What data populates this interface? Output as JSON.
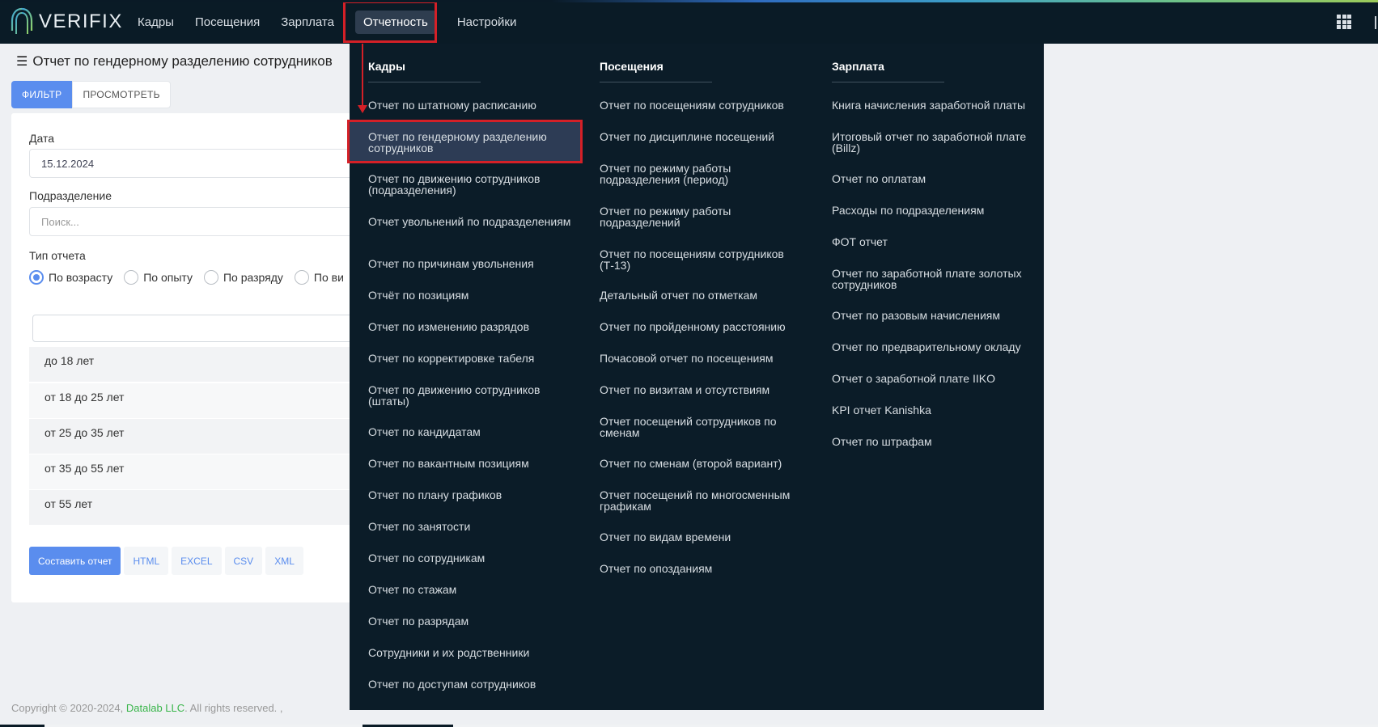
{
  "brand": {
    "name": "VERIFIX"
  },
  "nav": {
    "items": [
      "Кадры",
      "Посещения",
      "Зарплата",
      "Отчетность",
      "Настройки"
    ]
  },
  "page": {
    "title": "Отчет по гендерному разделению сотрудников",
    "tabs": {
      "filter": "ФИЛЬТР",
      "view": "ПРОСМОТРЕТЬ"
    }
  },
  "form": {
    "date_label": "Дата",
    "date_value": "15.12.2024",
    "division_label": "Подразделение",
    "division_placeholder": "Поиск...",
    "report_type_label": "Тип отчета",
    "radios": [
      "По возрасту",
      "По опыту",
      "По разряду",
      "По ви"
    ],
    "selected_radio": "По возрасту"
  },
  "age_groups": [
    "до 18 лет",
    "от 18 до 25 лет",
    "от 25 до 35 лет",
    "от 35 до 55 лет",
    "от 55 лет"
  ],
  "actions": {
    "generate": "Составить отчет",
    "formats": [
      "HTML",
      "EXCEL",
      "CSV",
      "XML"
    ]
  },
  "footer": {
    "copyright": "Copyright © 2020-2024,",
    "company": "Datalab LLC",
    "rights": ". All rights reserved. ,"
  },
  "menu": {
    "columns": [
      {
        "title": "Кадры",
        "items": [
          "Отчет по штатному расписанию",
          "Отчет по гендерному разделению сотрудников",
          "Отчет по движению сотрудников (подразделения)",
          "Отчет увольнений по подразделениям",
          "Отчет по причинам увольнения",
          "Отчёт по позициям",
          "Отчет по изменению разрядов",
          "Отчет по корректировке табеля",
          "Отчет по движению сотрудников (штаты)",
          "Отчет по кандидатам",
          "Отчет по вакантным позициям",
          "Отчет по плану графиков",
          "Отчет по занятости",
          "Отчет по сотрудникам",
          "Отчет по стажам",
          "Отчет по разрядам",
          "Сотрудники и их родственники",
          "Отчет по доступам сотрудников"
        ]
      },
      {
        "title": "Посещения",
        "items": [
          "Отчет по посещениям сотрудников",
          "Отчет по дисциплине посещений",
          "Отчет по режиму работы подразделения (период)",
          "Отчет по режиму работы подразделений",
          "Отчет по посещениям сотрудников (Т-13)",
          "Детальный отчет по отметкам",
          "Отчет по пройденному расстоянию",
          "Почасовой отчет по посещениям",
          "Отчет по визитам и отсутствиям",
          "Отчет посещений сотрудников по сменам",
          "Отчет по сменам (второй вариант)",
          "Отчет посещений по многосменным графикам",
          "Отчет по видам времени",
          "Отчет по опозданиям"
        ]
      },
      {
        "title": "Зарплата",
        "items": [
          "Книга начисления заработной платы",
          "Итоговый отчет по заработной плате (Billz)",
          "Отчет по оплатам",
          "Расходы по подразделениям",
          "ФОТ отчет",
          "Отчет по заработной плате золотых сотрудников",
          "Отчет по разовым начислениям",
          "Отчет по предварительному окладу",
          "Отчет о заработной плате IIKO",
          "KPI отчет Kanishka",
          "Отчет по штрафам"
        ]
      }
    ]
  }
}
